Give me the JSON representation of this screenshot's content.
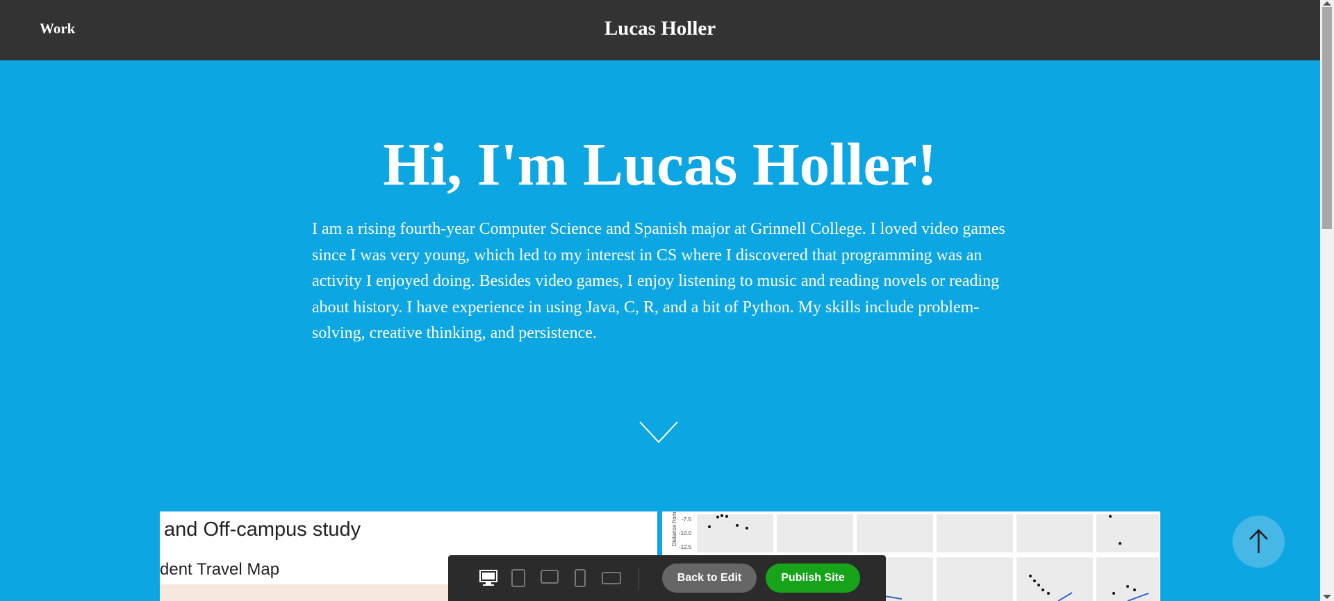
{
  "header": {
    "nav_work": "Work",
    "site_title": "Lucas Holler"
  },
  "hero": {
    "title": "Hi, I'm Lucas Holler!",
    "bio": "I am a rising fourth-year Computer Science and Spanish major at Grinnell College. I loved video games since I was very young, which led to my interest in CS where I discovered that programming was an activity I enjoyed doing. Besides video games, I enjoy listening to music and reading novels or reading about history. I have experience in using Java, C, R, and a bit of Python. My skills include problem-solving, creative thinking, and persistence.",
    "scroll_icon": "chevron-down-icon"
  },
  "projects": [
    {
      "thumb_title": "and Off-campus study",
      "thumb_subtitle": "dent Travel Map"
    },
    {
      "thumb_labels": [
        "-7.5",
        "-10.0",
        "-12.5"
      ],
      "thumb_axis": "Distance from"
    }
  ],
  "editor_bar": {
    "devices": [
      "desktop-icon",
      "tablet-portrait-icon",
      "tablet-landscape-icon",
      "phone-portrait-icon",
      "phone-landscape-icon"
    ],
    "back_label": "Back to Edit",
    "publish_label": "Publish Site"
  },
  "back_to_top_icon": "arrow-up-icon",
  "colors": {
    "header_bg": "#333333",
    "page_bg": "#0ca6e2",
    "publish_green": "#17a31a",
    "back_gray": "#666666"
  }
}
